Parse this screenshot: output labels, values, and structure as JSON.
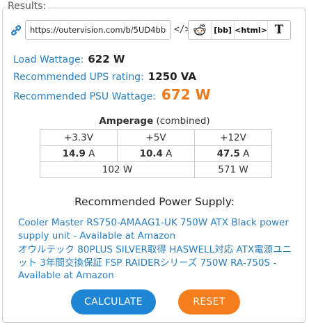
{
  "results": {
    "legend": "Results:",
    "share": {
      "url": "https://outervision.com/b/5UD4bb",
      "embed_glyph": "</>",
      "buttons": [
        {
          "label": "",
          "icon": "reddit-icon"
        },
        {
          "label": "[bb]"
        },
        {
          "label": "<html>"
        },
        {
          "label": "T"
        }
      ]
    },
    "stats": {
      "load_label": "Load Wattage:",
      "load_value": "622 W",
      "ups_label": "Recommended UPS rating:",
      "ups_value": "1250 VA",
      "psu_label": "Recommended PSU Wattage:",
      "psu_value": "672 W"
    },
    "amperage": {
      "title_bold": "Amperage",
      "title_rest": " (combined)",
      "rails": [
        "+3.3V",
        "+5V",
        "+12V"
      ],
      "amps": [
        "14.9",
        "10.4",
        "47.5"
      ],
      "unit": "A",
      "combined_3v_5v": "102 W",
      "combined_12v": "571 W"
    },
    "recommended": {
      "title": "Recommended Power Supply:",
      "products": [
        "Cooler Master RS750-AMAAG1-UK 750W ATX Black power supply unit - Available at Amazon",
        "オウルテック 80PLUS SILVER取得 HASWELL対応 ATX電源ユニット 3年間交換保証 FSP RAIDERシリーズ 750W RA-750S - Available at Amazon"
      ]
    },
    "actions": {
      "calculate": "CALCULATE",
      "reset": "RESET"
    }
  },
  "colors": {
    "link": "#2a7fc1",
    "accent_orange": "#f07b1d",
    "calc_button": "#1e86d4",
    "reset_button": "#f67d1b"
  }
}
